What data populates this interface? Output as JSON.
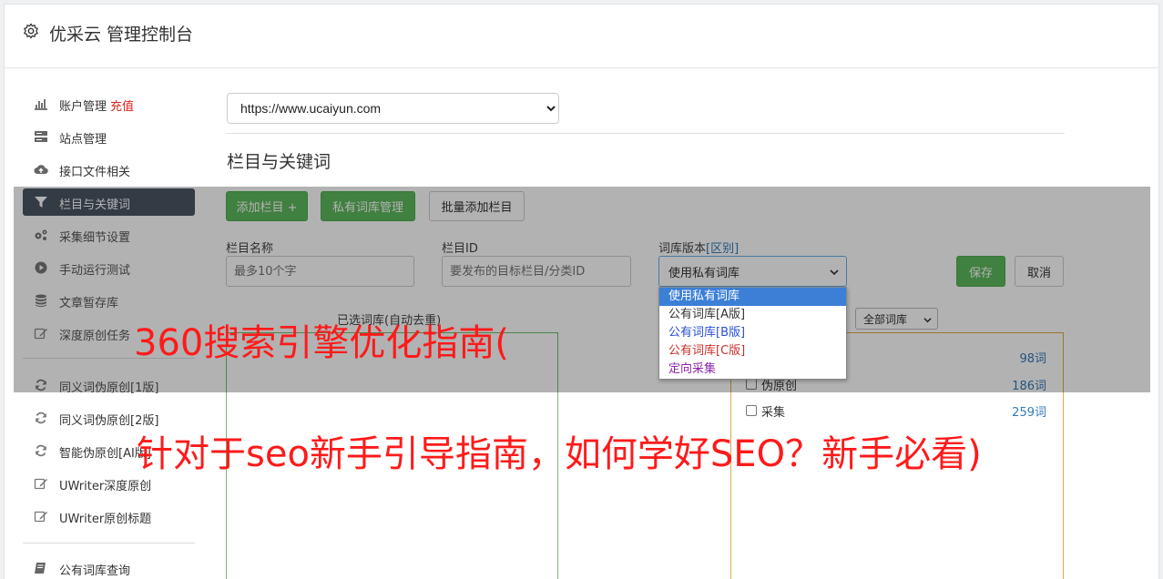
{
  "app": {
    "title": "优采云 管理控制台",
    "icon": "gear-icon"
  },
  "sidebar": {
    "items": [
      {
        "label": "账户管理",
        "extra": "充值",
        "icon": "bar-chart-icon"
      },
      {
        "label": "站点管理",
        "icon": "server-icon"
      },
      {
        "label": "接口文件相关",
        "icon": "cloud-upload-icon"
      },
      {
        "label": "栏目与关键词",
        "icon": "filter-icon",
        "active": true
      },
      {
        "label": "采集细节设置",
        "icon": "cogs-icon"
      },
      {
        "label": "手动运行测试",
        "icon": "play-circle-icon"
      },
      {
        "label": "文章暂存库",
        "icon": "database-icon"
      },
      {
        "label": "深度原创任务",
        "icon": "edit-icon"
      },
      {
        "label": "同义词伪原创[1版]",
        "icon": "refresh-icon"
      },
      {
        "label": "同义词伪原创[2版]",
        "icon": "refresh-icon"
      },
      {
        "label": "智能伪原创[AI版]",
        "icon": "refresh-icon"
      },
      {
        "label": "UWriter深度原创",
        "icon": "edit-icon"
      },
      {
        "label": "UWriter原创标题",
        "icon": "edit-icon"
      },
      {
        "label": "公有词库查询",
        "icon": "book-icon"
      }
    ]
  },
  "site_select": {
    "value": "https://www.ucaiyun.com"
  },
  "section_title": "栏目与关键词",
  "toolbar": {
    "add_column": "添加栏目 +",
    "private_lib": "私有词库管理",
    "batch_add": "批量添加栏目"
  },
  "form": {
    "name_label": "栏目名称",
    "name_placeholder": "最多10个字",
    "id_label": "栏目ID",
    "id_placeholder": "要发布的目标栏目/分类ID",
    "lib_version_label": "词库版本",
    "lib_version_link": "[区别]",
    "lib_version_value": "使用私有词库",
    "lib_options": [
      {
        "label": "使用私有词库",
        "color": "#ffffff",
        "selected": true
      },
      {
        "label": "公有词库[A版]",
        "color": "#333333"
      },
      {
        "label": "公有词库[B版]",
        "color": "#2a4fd6"
      },
      {
        "label": "公有词库[C版]",
        "color": "#c9302c"
      },
      {
        "label": "定向采集",
        "color": "#8e24aa"
      }
    ],
    "save": "保存",
    "cancel": "取消"
  },
  "keywords_panel": {
    "caption": "已选词库(自动去重)"
  },
  "library_panel": {
    "filter_value": "全部词库",
    "rows": [
      {
        "name": "",
        "count": "98词"
      },
      {
        "name": "伪原创",
        "count": "186词"
      },
      {
        "name": "采集",
        "count": "259词"
      }
    ]
  },
  "watermark": {
    "line1": "360搜索引擎优化指南(",
    "line2": "针对于seo新手引导指南，如何学好SEO？新手必看)"
  },
  "colors": {
    "accent_green": "#5cb85c",
    "sidebar_active": "#4a5564",
    "recharge_red": "#d9251d",
    "overlay_text": "#ff1a1a"
  }
}
